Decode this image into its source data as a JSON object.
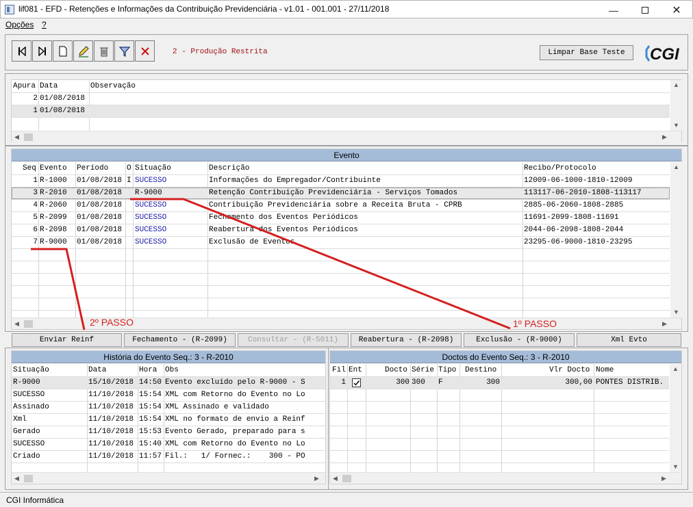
{
  "window": {
    "title": "lif081 - EFD - Retenções e Informações da Contribuição Previdenciária - v1.01 - 001.001 - 27/11/2018"
  },
  "menu": {
    "items": [
      "Opções",
      "?"
    ]
  },
  "toolbar": {
    "environment": "2 - Produção Restrita",
    "clear_button": "Limpar Base Teste",
    "logo": "CGI"
  },
  "apuracao": {
    "columns": [
      "Apura",
      "Data",
      "Observação"
    ],
    "rows": [
      {
        "apura": "2",
        "data": "01/08/2018",
        "obs": ""
      },
      {
        "apura": "1",
        "data": "01/08/2018",
        "obs": ""
      }
    ]
  },
  "evento": {
    "title": "Evento",
    "columns": [
      "Seq",
      "Evento",
      "Período",
      "O",
      "Situação",
      "Descrição",
      "Recibo/Protocolo"
    ],
    "rows": [
      {
        "seq": "1",
        "evento": "R-1000",
        "periodo": "01/08/2018",
        "o": "I",
        "situacao": "SUCESSO",
        "descricao": "Informações do Empregador/Contribuinte",
        "recibo": "12009-06-1000-1810-12009"
      },
      {
        "seq": "3",
        "evento": "R-2010",
        "periodo": "01/08/2018",
        "o": "",
        "situacao": "R-9000",
        "descricao": "Retenção Contribuição Previdenciária - Serviços Tomados",
        "recibo": "113117-06-2010-1808-113117"
      },
      {
        "seq": "4",
        "evento": "R-2060",
        "periodo": "01/08/2018",
        "o": "",
        "situacao": "SUCESSO",
        "descricao": "Contribuição Previdenciária sobre a Receita Bruta - CPRB",
        "recibo": "2885-06-2060-1808-2885"
      },
      {
        "seq": "5",
        "evento": "R-2099",
        "periodo": "01/08/2018",
        "o": "",
        "situacao": "SUCESSO",
        "descricao": "Fechamento dos Eventos Periódicos",
        "recibo": "11691-2099-1808-11691"
      },
      {
        "seq": "6",
        "evento": "R-2098",
        "periodo": "01/08/2018",
        "o": "",
        "situacao": "SUCESSO",
        "descricao": "Reabertura dos Eventos Periódicos",
        "recibo": "2044-06-2098-1808-2044"
      },
      {
        "seq": "7",
        "evento": "R-9000",
        "periodo": "01/08/2018",
        "o": "",
        "situacao": "SUCESSO",
        "descricao": "Exclusão de Eventos",
        "recibo": "23295-06-9000-1810-23295"
      }
    ],
    "annotations": {
      "step2": "2º PASSO",
      "step1": "1º PASSO"
    }
  },
  "actions": [
    "Enviar Reinf",
    "Fechamento - (R-2099)",
    "Consultar - (R-5011)",
    "Reabertura - (R-2098)",
    "Exclusão - (R-9000)",
    "Xml Evto"
  ],
  "historia": {
    "title": "História do Evento Seq.: 3 - R-2010",
    "columns": [
      "Situação",
      "Data",
      "Hora",
      "Obs"
    ],
    "rows": [
      {
        "situacao": "R-9000",
        "data": "15/10/2018",
        "hora": "14:50",
        "obs": "Evento excluído pelo R-9000 - S"
      },
      {
        "situacao": "SUCESSO",
        "data": "11/10/2018",
        "hora": "15:54",
        "obs": "XML com Retorno do Evento no Lo"
      },
      {
        "situacao": "Assinado",
        "data": "11/10/2018",
        "hora": "15:54",
        "obs": "XML Assinado e validado"
      },
      {
        "situacao": "Xml",
        "data": "11/10/2018",
        "hora": "15:54",
        "obs": "XML no formato de envio a Reinf"
      },
      {
        "situacao": "Gerado",
        "data": "11/10/2018",
        "hora": "15:53",
        "obs": "Evento Gerado, preparado para s"
      },
      {
        "situacao": "SUCESSO",
        "data": "11/10/2018",
        "hora": "15:40",
        "obs": "XML com Retorno do Evento no Lo"
      },
      {
        "situacao": "Criado",
        "data": "11/10/2018",
        "hora": "11:57",
        "obs": "Fil.:   1/ Fornec.:    300 - PO"
      }
    ]
  },
  "doctos": {
    "title": "Doctos do Evento Seq.: 3 - R-2010",
    "columns": [
      "Fil",
      "Ent",
      "Docto",
      "Série",
      "Tipo",
      "Destino",
      "Vlr Docto",
      "Nome"
    ],
    "rows": [
      {
        "fil": "1",
        "ent": true,
        "docto": "300",
        "serie": "300",
        "tipo": "F",
        "destino": "300",
        "vlr": "300,00",
        "nome": "PONTES DISTRIB."
      }
    ]
  },
  "status": {
    "text": "CGI Informática"
  },
  "colors": {
    "accent_header": "#a5bcd8",
    "sucesso": "#1a1aa6",
    "annotation": "#d42020",
    "env": "#a01010"
  }
}
